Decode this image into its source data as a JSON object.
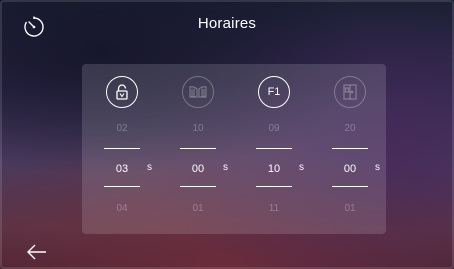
{
  "header": {
    "title": "Horaires",
    "timer_icon": "timer-icon",
    "back_icon": "back-arrow-icon"
  },
  "columns": [
    {
      "icon": "unlock-icon",
      "active": true,
      "prev": "02",
      "value": "03",
      "unit": "s",
      "next": "04"
    },
    {
      "icon": "gate-icon",
      "active": false,
      "prev": "10",
      "value": "00",
      "unit": "s",
      "next": "01"
    },
    {
      "icon": "f1-icon",
      "icon_label": "F1",
      "active": true,
      "prev": "09",
      "value": "10",
      "unit": "s",
      "next": "11"
    },
    {
      "icon": "door-icon",
      "active": false,
      "prev": "20",
      "value": "00",
      "unit": "s",
      "next": "01"
    }
  ]
}
